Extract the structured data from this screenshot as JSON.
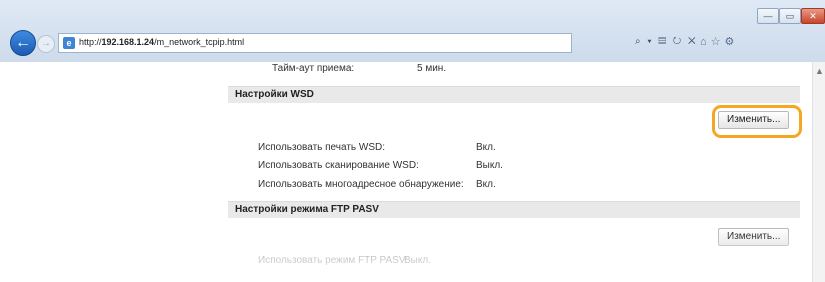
{
  "browser": {
    "url_prefix": "http://",
    "url_host": "192.168.1.24",
    "url_path": "/m_network_tcpip.html",
    "addr_tools": "⌕ ▾ ▤ ↻ ✕",
    "window_min": "—",
    "window_max": "▭",
    "window_close": "✕",
    "back_glyph": "←",
    "forward_glyph": "→"
  },
  "page": {
    "timeout_label": "Тайм-аут приема:",
    "timeout_value": "5 мин.",
    "wsd": {
      "title": "Настройки WSD",
      "change_button": "Изменить...",
      "rows": [
        {
          "label": "Использовать печать WSD:",
          "value": "Вкл."
        },
        {
          "label": "Использовать сканирование WSD:",
          "value": "Выкл."
        },
        {
          "label": "Использовать многоадресное обнаружение:",
          "value": "Вкл."
        }
      ]
    },
    "ftp": {
      "title": "Настройки режима FTP PASV",
      "change_button": "Изменить...",
      "row_label": "Использовать режим FTP PASV:",
      "row_value": "Выкл."
    }
  },
  "colors": {
    "highlight": "#f5a623",
    "section_bg": "#e9e9e9",
    "chrome": "#cddbeb"
  }
}
